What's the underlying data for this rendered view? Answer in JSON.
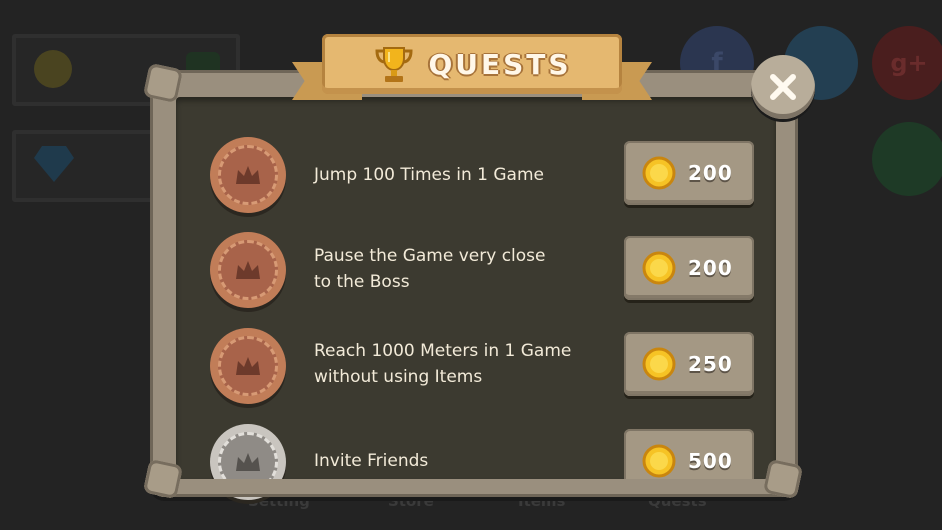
{
  "header": {
    "title": "QUESTS",
    "trophy_icon": "trophy-icon"
  },
  "close_icon": "close-icon",
  "quests": [
    {
      "text": "Jump 100 Times in 1 Game",
      "reward": "200",
      "medal": "bronze"
    },
    {
      "text": "Pause the Game very close\nto the Boss",
      "reward": "200",
      "medal": "bronze"
    },
    {
      "text": "Reach 1000 Meters in 1 Game\nwithout using Items",
      "reward": "250",
      "medal": "bronze"
    },
    {
      "text": "Invite Friends",
      "reward": "500",
      "medal": "silver"
    }
  ],
  "background": {
    "social": [
      {
        "label": "f",
        "icon": "facebook-icon",
        "color": "#2b3650"
      },
      {
        "label": "",
        "icon": "twitter-icon",
        "color": "#233f52"
      },
      {
        "label": "g+",
        "icon": "google-plus-icon",
        "color": "#4a1e1e"
      },
      {
        "label": "",
        "icon": "share-arrow-icon",
        "color": "#1e3a26"
      }
    ],
    "tabs": [
      "Setting",
      "Store",
      "Items",
      "Quests"
    ]
  },
  "colors": {
    "panel": "#3c3a30",
    "banner": "#e5b870",
    "stone": "#9a8f7e",
    "text": "#f2ead8"
  }
}
